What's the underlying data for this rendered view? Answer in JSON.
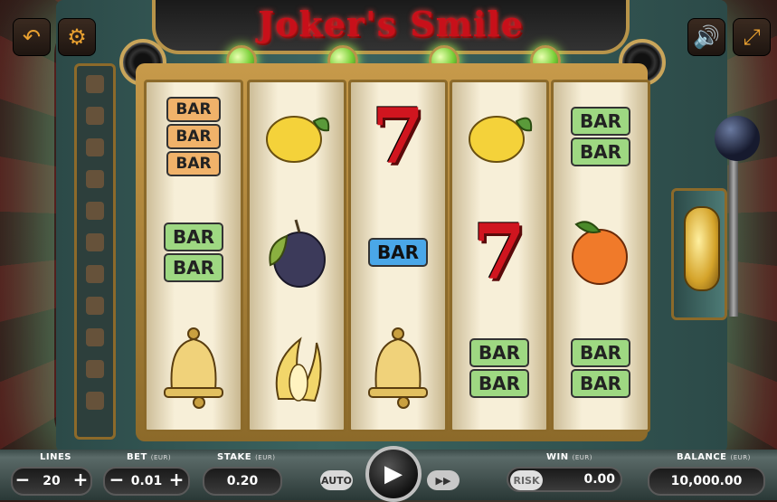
{
  "game": {
    "title": "Joker's Smile"
  },
  "top_buttons": {
    "back_icon": "back-arrow-icon",
    "settings_icon": "settings-gear-icon",
    "sound_icon": "speaker-icon",
    "fullscreen_icon": "fullscreen-icon"
  },
  "reels": [
    {
      "symbols": [
        "BAR BAR BAR",
        "BAR BAR",
        "bell"
      ]
    },
    {
      "symbols": [
        "lemon",
        "plum",
        "banana"
      ]
    },
    {
      "symbols": [
        "7",
        "BAR",
        "bell"
      ]
    },
    {
      "symbols": [
        "lemon",
        "7",
        "BAR BAR"
      ]
    },
    {
      "symbols": [
        "BAR BAR",
        "orange",
        "BAR BAR"
      ]
    }
  ],
  "bar_text": "BAR",
  "seven_text": "7",
  "controls": {
    "lines": {
      "label": "LINES",
      "value": "20",
      "minus": "−",
      "plus": "+"
    },
    "bet": {
      "label": "BET",
      "unit": "(EUR)",
      "value": "0.01",
      "minus": "−",
      "plus": "+"
    },
    "stake": {
      "label": "STAKE",
      "unit": "(EUR)",
      "value": "0.20"
    },
    "auto": "AUTO",
    "spin": "▶",
    "turbo": "▶▶",
    "win": {
      "label": "WIN",
      "unit": "(EUR)",
      "value": "0.00",
      "risk": "RISK"
    },
    "balance": {
      "label": "BALANCE",
      "unit": "(EUR)",
      "value": "10,000.00"
    }
  }
}
